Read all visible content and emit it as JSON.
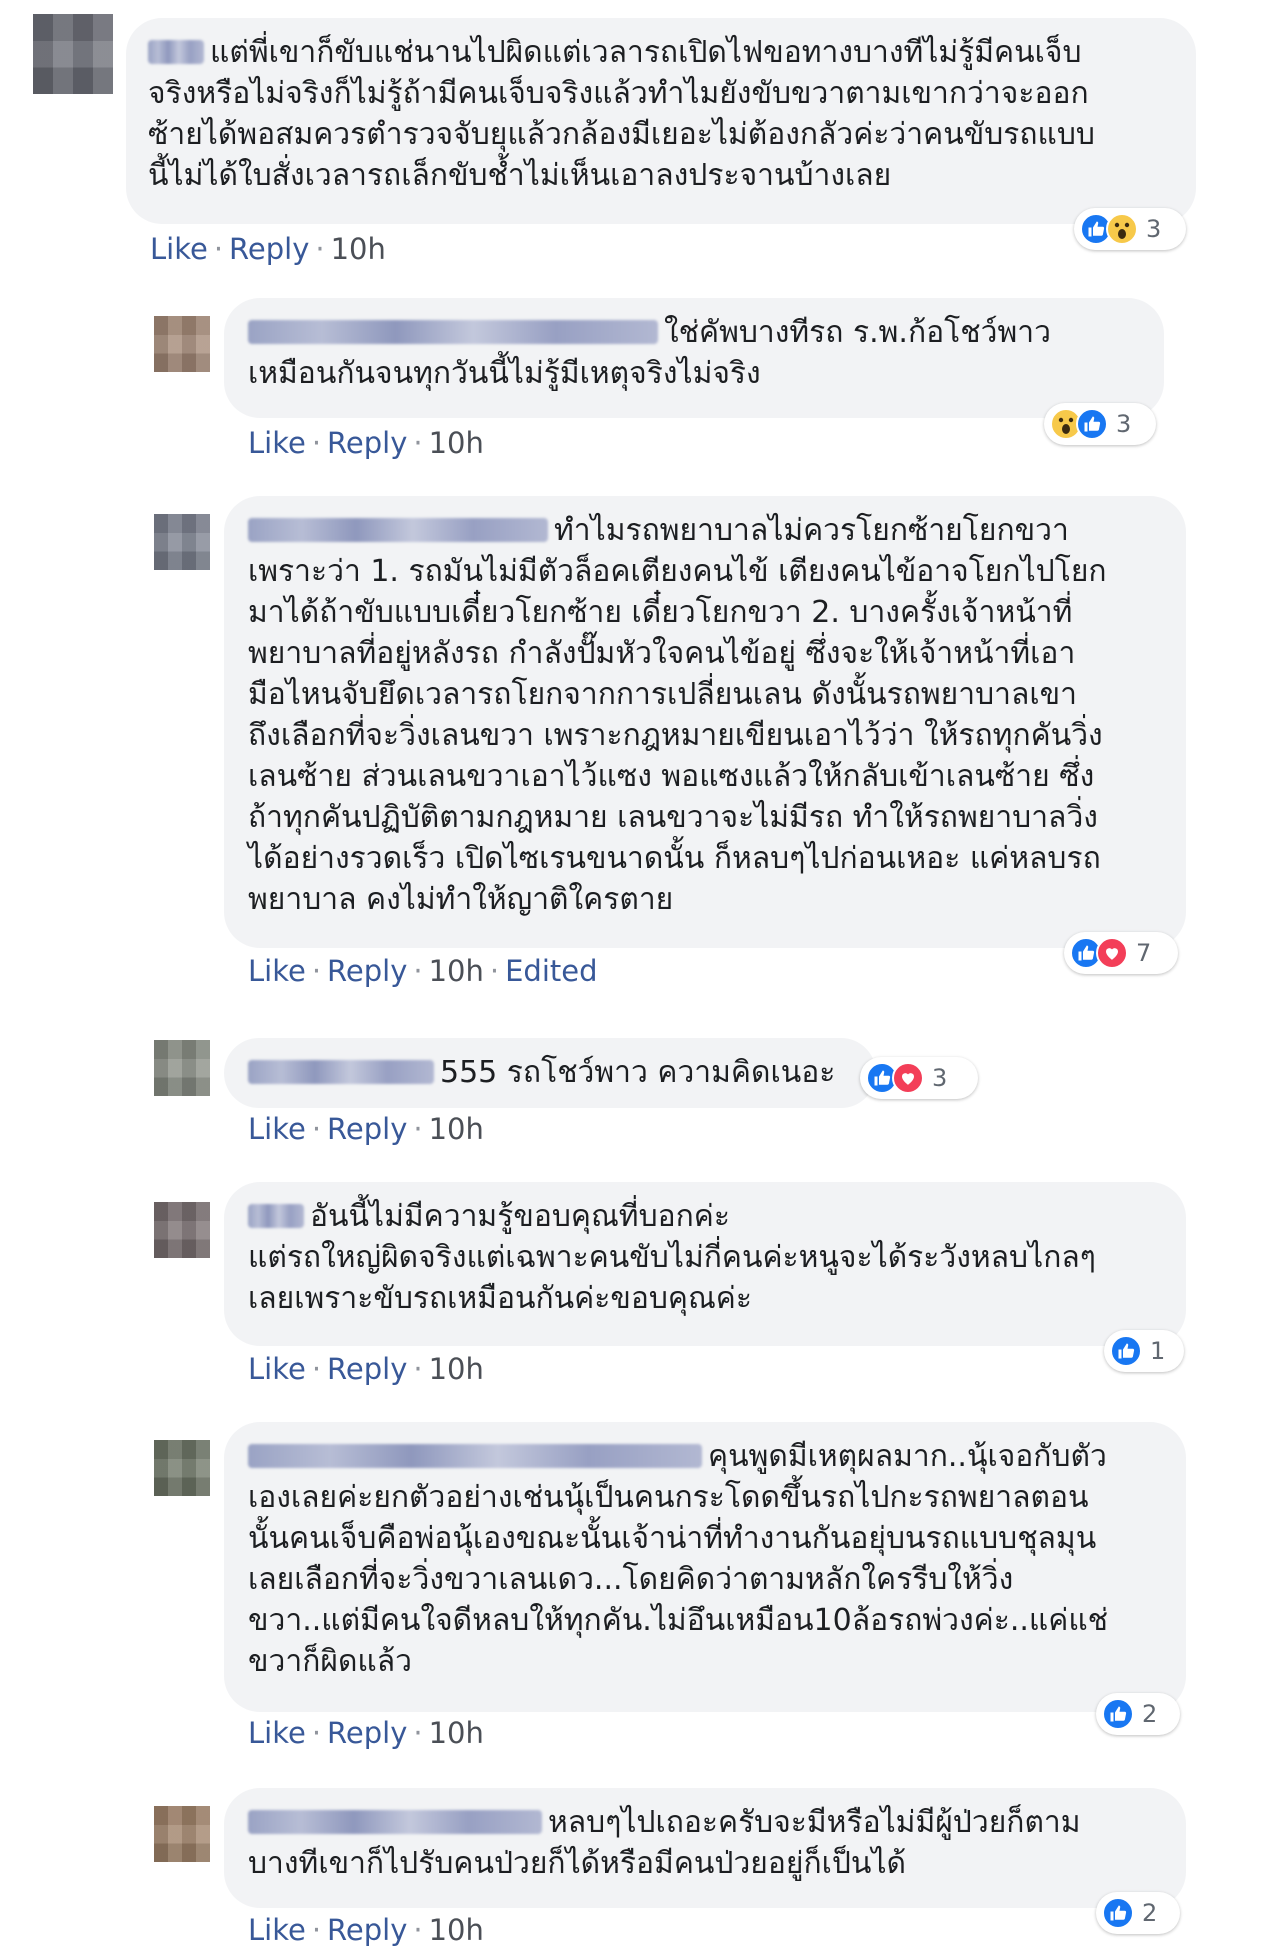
{
  "comments": [
    {
      "avatar_color": "#6d6f78",
      "name_width": 56,
      "lines": [
        "แต่พี่เขาก็ขับแช่นานไปผิดแต่เวลารถเปิดไฟขอทางบางทีไม่รู้มีคนเจ็บ",
        "จริงหรือไม่จริงก็ไม่รู้ถ้ามีคนเจ็บจริงแล้วทำไมยังขับขวาตามเขากว่าจะออก",
        "ซ้ายได้พอสมควรตำรวจจับยุแล้วกล้องมีเยอะไม่ต้องกลัวค่ะว่าคนขับรถแบบ",
        "นี้ไม่ได้ใบสั่งเวลารถเล็กขับช้ำไม่เห็นเอาลงประจานบ้างเลย"
      ],
      "like": "Like",
      "reply": "Reply",
      "time": "10h",
      "reactions": [
        "like",
        "wow"
      ],
      "reaction_count": "3"
    },
    {
      "avatar_color": "#a58a78",
      "name_width": 410,
      "lines": [
        "ใช่คัพบางทีรถ ร.พ.ก้อโชว์พาว",
        "เหมือนกันจนทุกวันนี้ไม่รู้มีเหตุจริงไม่จริง"
      ],
      "like": "Like",
      "reply": "Reply",
      "time": "10h",
      "reactions": [
        "wow",
        "like"
      ],
      "reaction_count": "3"
    },
    {
      "avatar_color": "#7d8290",
      "name_width": 300,
      "lines": [
        "ทำไมรถพยาบาลไม่ควรโยกซ้ายโยกขวา",
        "เพราะว่า 1. รถมันไม่มีตัวล็อคเตียงคนไข้ เตียงคนไข้อาจโยกไปโยก",
        "มาได้ถ้าขับแบบเดี๋ยวโยกซ้าย เดี๋ยวโยกขวา 2. บางครั้งเจ้าหน้าที่",
        "พยาบาลที่อยู่หลังรถ กำลังปั๊มหัวใจคนไข้อยู่ ซึ่งจะให้เจ้าหน้าที่เอา",
        "มือไหนจับยึดเวลารถโยกจากการเปลี่ยนเลน ดังนั้นรถพยาบาลเขา",
        "ถึงเลือกที่จะวิ่งเลนขวา เพราะกฎหมายเขียนเอาไว้ว่า ให้รถทุกคันวิ่ง",
        "เลนซ้าย ส่วนเลนขวาเอาไว้แซง พอแซงแล้วให้กลับเข้าเลนซ้าย ซึ่ง",
        "ถ้าทุกคันปฏิบัติตามกฎหมาย เลนขวาจะไม่มีรถ ทำให้รถพยาบาลวิ่ง",
        "ได้อย่างรวดเร็ว เปิดไซเรนขนาดนั้น ก็หลบๆไปก่อนเหอะ แค่หลบรถ",
        "พยาบาล คงไม่ทำให้ญาติใครตาย"
      ],
      "like": "Like",
      "reply": "Reply",
      "time": "10h",
      "edited": "Edited",
      "reactions": [
        "like",
        "love"
      ],
      "reaction_count": "7"
    },
    {
      "avatar_color": "#8a8f86",
      "name_width": 186,
      "lines": [
        "555 รถโชว์พาว ความคิดเนอะ"
      ],
      "like": "Like",
      "reply": "Reply",
      "time": "10h",
      "reactions": [
        "like",
        "love"
      ],
      "reaction_count": "3"
    },
    {
      "avatar_color": "#7a7072",
      "name_width": 56,
      "lines": [
        "อันนี้ไม่มีความรู้ขอบคุณที่บอกค่ะ",
        "แต่รถใหญ่ผิดจริงแต่เฉพาะคนขับไม่กี่คนค่ะหนูจะได้ระวังหลบไกลๆ",
        "เลยเพราะขับรถเหมือนกันค่ะขอบคุณค่ะ"
      ],
      "like": "Like",
      "reply": "Reply",
      "time": "10h",
      "reactions": [
        "like"
      ],
      "reaction_count": "1"
    },
    {
      "avatar_color": "#6f7768",
      "name_width": 454,
      "lines": [
        "คุนพูดมีเหตุผลมาก..นุ้เจอกับตัว",
        "เองเลยค่ะยกตัวอย่างเช่นนุ้เป็นคนกระโดดขึ้นรถไปกะรถพยาลตอน",
        "นั้นคนเจ็บคือพ่อนุ้เองขณะนั้นเจ้าน่าที่ทำงานกันอยุ่บนรถแบบชุลมุน",
        "เลยเลือกที่จะวิ่งขวาเลนเดว...โดยคิดว่าตามหลักใครรีบให้วิ่ง",
        "ขวา..แต่มีคนใจดีหลบให้ทุกคัน.ไม่อึนเหมือน10ล้อรถพ่วงค่ะ..แค่แช่",
        "ขวาก็ผิดแล้ว"
      ],
      "like": "Like",
      "reply": "Reply",
      "time": "10h",
      "reactions": [
        "like"
      ],
      "reaction_count": "2"
    },
    {
      "avatar_color": "#a0836a",
      "name_width": 294,
      "lines": [
        "หลบๆไปเถอะครับจะมีหรือไม่มีผู้ป่วยก็ตาม",
        "บางทีเขาก็ไปรับคนป่วยก็ได้หรือมีคนป่วยอยู่ก็เป็นได้"
      ],
      "like": "Like",
      "reply": "Reply",
      "time": "10h",
      "reactions": [
        "like"
      ],
      "reaction_count": "2"
    }
  ]
}
